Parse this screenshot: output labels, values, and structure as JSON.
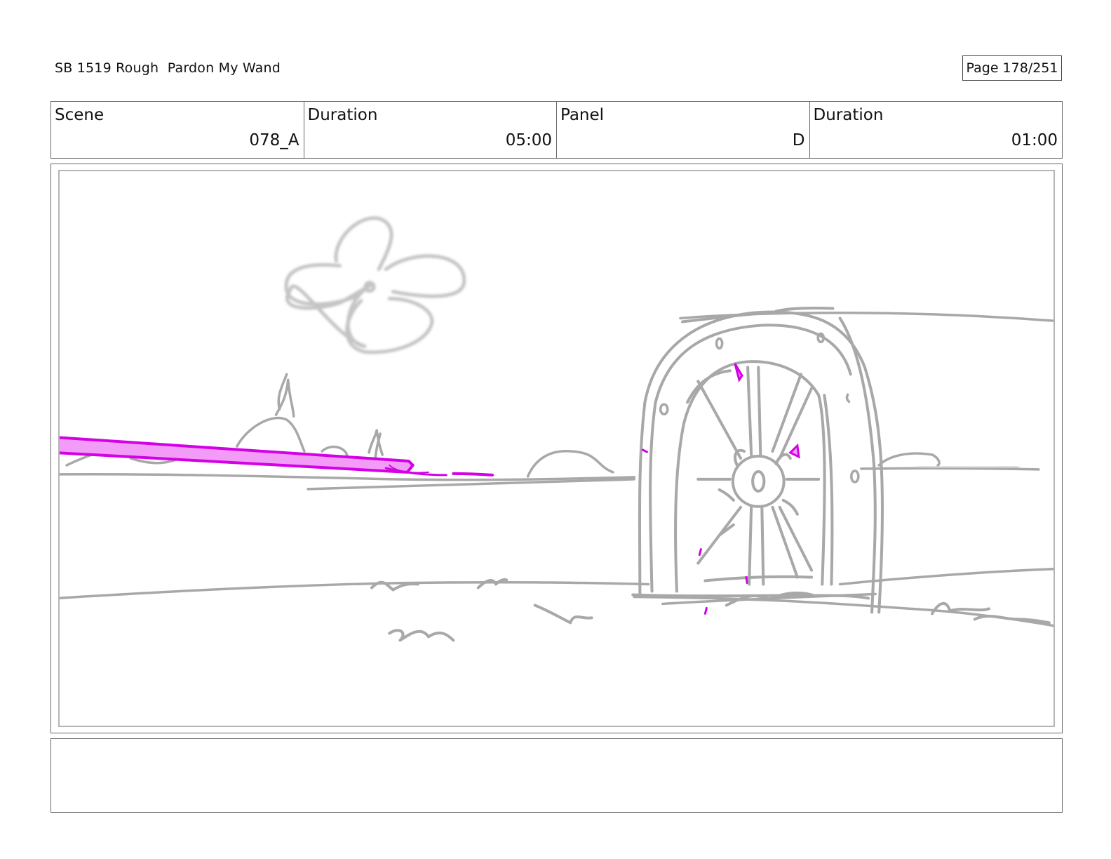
{
  "header": {
    "title": "SB 1519 Rough  Pardon My Wand",
    "page": "Page 178/251"
  },
  "info": {
    "scene_label": "Scene",
    "scene_value": "078_A",
    "scene_duration_label": "Duration",
    "scene_duration_value": "05:00",
    "panel_label": "Panel",
    "panel_value": "D",
    "panel_duration_label": "Duration",
    "panel_duration_value": "01:00"
  },
  "colors": {
    "sketch": "#a6a6a6",
    "magic": "#d400e6",
    "magic_fill": "#f29cf7"
  },
  "notes": {
    "text": ""
  }
}
